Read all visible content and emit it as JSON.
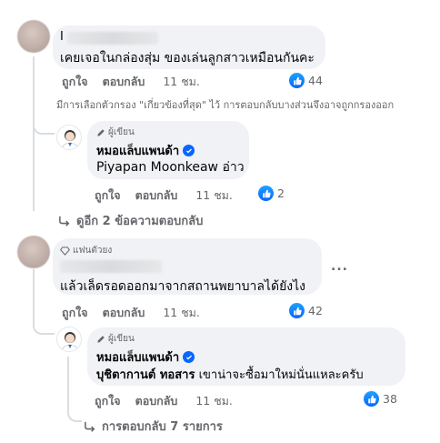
{
  "comments": [
    {
      "author_initial": "I",
      "text": "เคยเจอในกล่องสุ่ม ของเล่นลูกสาวเหมือนกันคะ",
      "like_label": "ถูกใจ",
      "reply_label": "ตอบกลับ",
      "time": "11 ชม.",
      "reaction_count": "44",
      "filter_notice": "มีการเลือกตัวกรอง \"เกี่ยวข้องที่สุด\" ไว้ การตอบกลับบางส่วนจึงอาจถูกกรองออก",
      "reply": {
        "badge": "ผู้เขียน",
        "author": "หมอแล็บแพนด้า",
        "mention": "Piyapan Moonkeaw",
        "text": "อ่าว",
        "like_label": "ถูกใจ",
        "reply_label": "ตอบกลับ",
        "time": "11 ชม.",
        "reaction_count": "2"
      },
      "more_replies": "ดูอีก 2 ข้อความตอบกลับ"
    },
    {
      "badge": "แฟนตัวยง",
      "text": "แล้วเล็ดรอดออกมาจากสถานพยาบาลได้ยังไง",
      "more_options": "...",
      "like_label": "ถูกใจ",
      "reply_label": "ตอบกลับ",
      "time": "11 ชม.",
      "reaction_count": "42",
      "reply": {
        "badge": "ผู้เขียน",
        "author": "หมอแล็บแพนด้า",
        "mention": "บุชิตากานต์ ทอสาร",
        "text": "เขาน่าจะซื้อมาใหม่นั่นแหละครับ",
        "like_label": "ถูกใจ",
        "reply_label": "ตอบกลับ",
        "time": "11 ชม.",
        "reaction_count": "38"
      },
      "more_replies": "การตอบกลับ 7 รายการ"
    }
  ],
  "colors": {
    "bubble": "#f0f2f5",
    "meta": "#65676b",
    "like_blue": "#0866ff",
    "thread_line": "#dadde1"
  },
  "icons": [
    "author-pen-icon",
    "verified-badge-icon",
    "like-reaction-icon",
    "reply-arrow-icon",
    "diamond-fan-icon"
  ]
}
